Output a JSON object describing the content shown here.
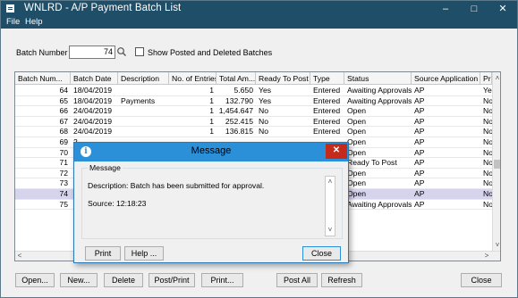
{
  "window": {
    "title": "WNLRD - A/P Payment Batch List",
    "minimize": "–",
    "maximize": "□",
    "close": "✕"
  },
  "menu": {
    "file": "File",
    "help": "Help"
  },
  "filter": {
    "batch_label": "Batch Number",
    "batch_value": "74",
    "show_label": "Show Posted and Deleted Batches",
    "show_checked": false
  },
  "grid": {
    "columns": [
      "Batch Num...",
      "Batch Date",
      "Description",
      "No. of Entries",
      "Total Am...",
      "Ready To Post",
      "Type",
      "Status",
      "Source Application",
      "Prin"
    ],
    "rows": [
      {
        "num": "64",
        "date": "18/04/2019",
        "desc": "",
        "entries": "1",
        "total": "5.650",
        "ready": "Yes",
        "type": "Entered",
        "status": "Awaiting Approvals",
        "source": "AP",
        "print": "Yes"
      },
      {
        "num": "65",
        "date": "18/04/2019",
        "desc": "Payments",
        "entries": "1",
        "total": "132.790",
        "ready": "Yes",
        "type": "Entered",
        "status": "Awaiting Approvals",
        "source": "AP",
        "print": "No"
      },
      {
        "num": "66",
        "date": "24/04/2019",
        "desc": "",
        "entries": "1",
        "total": "1,454.647",
        "ready": "No",
        "type": "Entered",
        "status": "Open",
        "source": "AP",
        "print": "No"
      },
      {
        "num": "67",
        "date": "24/04/2019",
        "desc": "",
        "entries": "1",
        "total": "252.415",
        "ready": "No",
        "type": "Entered",
        "status": "Open",
        "source": "AP",
        "print": "No"
      },
      {
        "num": "68",
        "date": "24/04/2019",
        "desc": "",
        "entries": "1",
        "total": "136.815",
        "ready": "No",
        "type": "Entered",
        "status": "Open",
        "source": "AP",
        "print": "No"
      },
      {
        "num": "69",
        "date": "2",
        "desc": "",
        "entries": "",
        "total": "",
        "ready": "",
        "type": "",
        "status": "Open",
        "source": "AP",
        "print": "No"
      },
      {
        "num": "70",
        "date": "2",
        "desc": "",
        "entries": "",
        "total": "",
        "ready": "",
        "type": "",
        "status": "Open",
        "source": "AP",
        "print": "No"
      },
      {
        "num": "71",
        "date": "2",
        "desc": "",
        "entries": "",
        "total": "",
        "ready": "",
        "type": "",
        "status": "Ready To Post",
        "source": "AP",
        "print": "No"
      },
      {
        "num": "72",
        "date": "2",
        "desc": "",
        "entries": "",
        "total": "",
        "ready": "",
        "type": "",
        "status": "Open",
        "source": "AP",
        "print": "No"
      },
      {
        "num": "73",
        "date": "2",
        "desc": "",
        "entries": "",
        "total": "",
        "ready": "",
        "type": "",
        "status": "Open",
        "source": "AP",
        "print": "No"
      },
      {
        "num": "74",
        "date": "2",
        "desc": "",
        "entries": "",
        "total": "",
        "ready": "",
        "type": "",
        "status": "Open",
        "source": "AP",
        "print": "No"
      },
      {
        "num": "75",
        "date": "2",
        "desc": "",
        "entries": "",
        "total": "",
        "ready": "",
        "type": "",
        "status": "Awaiting Approvals",
        "source": "AP",
        "print": "No"
      }
    ],
    "selected_row": "74"
  },
  "buttons": {
    "open": "Open...",
    "new": "New...",
    "delete": "Delete",
    "post_print": "Post/Print",
    "print": "Print...",
    "post_all": "Post All",
    "refresh": "Refresh",
    "close": "Close"
  },
  "dialog": {
    "title": "Message",
    "group_label": "Message",
    "description": "Description: Batch has been submitted for approval.",
    "source": "Source:  12:18:23",
    "print": "Print",
    "help": "Help ...",
    "close": "Close"
  },
  "colors": {
    "titlebar": "#1f4e68",
    "dialog_title": "#2c90d8",
    "selected_row": "#d6d3ec",
    "close_red": "#c42b1c"
  },
  "icons": [
    "app-icon",
    "finder-icon",
    "info-icon",
    "close-icon"
  ]
}
